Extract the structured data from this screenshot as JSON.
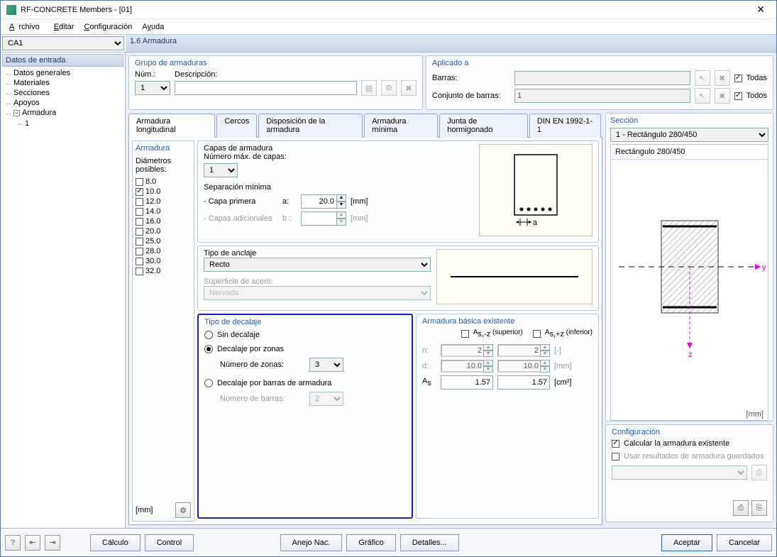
{
  "window": {
    "title": "RF-CONCRETE Members - [01]"
  },
  "menu": {
    "archivo": "Archivo",
    "editar": "Editar",
    "config": "Configuración",
    "ayuda": "Ayuda"
  },
  "caseSelect": "CA1",
  "pageTitle": "1.6 Armadura",
  "tree": {
    "header": "Datos de entrada",
    "items": [
      "Datos generales",
      "Materiales",
      "Secciones",
      "Apoyos"
    ],
    "armadura": "Armadura",
    "armaduraChild": "1"
  },
  "grupo": {
    "title": "Grupo de armaduras",
    "numLabel": "Núm.:",
    "numValue": "1",
    "descLabel": "Descripción:",
    "descValue": ""
  },
  "aplicado": {
    "title": "Aplicado a",
    "barrasLabel": "Barras:",
    "barrasValue": "",
    "conjuntoLabel": "Conjunto de barras:",
    "conjuntoValue": "1",
    "todas": "Todas",
    "todos": "Todos"
  },
  "tabs": [
    "Armadura longitudinal",
    "Cercos",
    "Disposición de la armadura",
    "Armadura mínima",
    "Junta de hormigonado",
    "DIN EN 1992-1-1"
  ],
  "armaduraPanel": {
    "title": "Armadura",
    "diamHeader": "Diámetros posibles:",
    "diams": [
      {
        "v": "8.0",
        "c": false
      },
      {
        "v": "10.0",
        "c": true
      },
      {
        "v": "12.0",
        "c": false
      },
      {
        "v": "14.0",
        "c": false
      },
      {
        "v": "16.0",
        "c": false
      },
      {
        "v": "20.0",
        "c": false
      },
      {
        "v": "25.0",
        "c": false
      },
      {
        "v": "28.0",
        "c": false
      },
      {
        "v": "30.0",
        "c": false
      },
      {
        "v": "32.0",
        "c": false
      }
    ],
    "unit": "[mm]"
  },
  "capas": {
    "title": "Capas de armadura",
    "numMax": "Número máx. de capas:",
    "numMaxVal": "1",
    "sepMin": "Separación mínima",
    "capa1": "- Capa primera",
    "aLbl": "a:",
    "aVal": "20.0",
    "capaAdd": "- Capas adicionales",
    "bLbl": "b :",
    "bVal": "",
    "mm": "[mm]"
  },
  "anclaje": {
    "title": "Tipo de anclaje",
    "tipo": "Recto",
    "supLabel": "Superficie de acero:",
    "supVal": "Nervada"
  },
  "decalaje": {
    "title": "Tipo de decalaje",
    "sin": "Sin decalaje",
    "zonas": "Decalaje por zonas",
    "numZonasLbl": "Número de zonas:",
    "numZonasVal": "3",
    "barras": "Decalaje por barras de armadura",
    "numBarrasLbl": "Número de barras:",
    "numBarrasVal": "2"
  },
  "basica": {
    "title": "Armadura básica existente",
    "as_sup": "As,-z (superior)",
    "as_inf": "As,+z (inferior)",
    "nLbl": "n:",
    "n1": "2",
    "n2": "2",
    "nUnit": "[-]",
    "dLbl": "d:",
    "d1": "10.0",
    "d2": "10.0",
    "dUnit": "[mm]",
    "asLbl": "As",
    "as1": "1.57",
    "as2": "1.57",
    "asUnit": "[cm²]"
  },
  "seccion": {
    "title": "Sección",
    "sel": "1 - Rectángulo 280/450",
    "desc": "Rectángulo 280/450",
    "mm": "[mm]",
    "y": "y",
    "z": "z"
  },
  "config": {
    "title": "Configuración",
    "calc": "Calcular la armadura existente",
    "usar": "Usar resultados de armadura guardados"
  },
  "footer": {
    "calculo": "Cálculo",
    "control": "Control",
    "anejo": "Anejo Nac.",
    "grafico": "Gráfico",
    "detalles": "Detalles...",
    "aceptar": "Aceptar",
    "cancelar": "Cancelar"
  }
}
